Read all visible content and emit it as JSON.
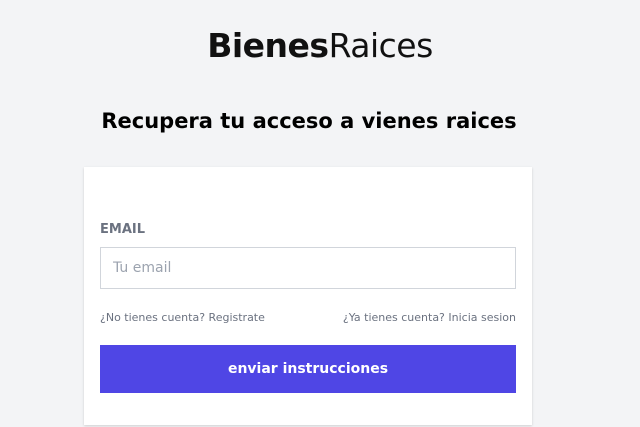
{
  "header": {
    "logo_bold": "Bienes",
    "logo_light": "Raices",
    "title": "Recupera tu acceso a vienes raices"
  },
  "form": {
    "email_label": "EMAIL",
    "email_placeholder": "Tu email",
    "email_value": "",
    "register_link": "¿No tienes cuenta? Registrate",
    "login_link": "¿Ya tienes cuenta? Inicia sesion",
    "submit_label": "enviar instrucciones"
  },
  "colors": {
    "primary": "#4f46e5",
    "background": "#f3f4f6",
    "card": "#ffffff",
    "label": "#6b7280"
  }
}
